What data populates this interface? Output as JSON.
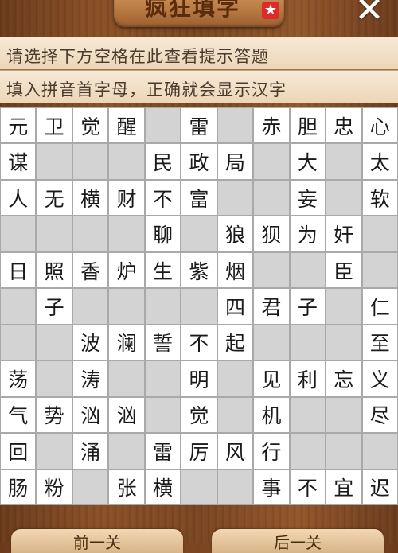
{
  "header": {
    "title": "疯狂填字",
    "close_icon": "close-icon"
  },
  "hints": {
    "line1": "请选择下方空格在此查看提示答题",
    "line2": "填入拼音首字母，正确就会显示汉字"
  },
  "grid": [
    [
      "元",
      "卫",
      "觉",
      "醒",
      "",
      "雷",
      "",
      "赤",
      "胆",
      "忠",
      "心"
    ],
    [
      "谋",
      "",
      "",
      "",
      "民",
      "政",
      "局",
      "",
      "大",
      "",
      "太"
    ],
    [
      "人",
      "无",
      "横",
      "财",
      "不",
      "富",
      "",
      "",
      "妄",
      "",
      "软"
    ],
    [
      "",
      "",
      "",
      "",
      "聊",
      "",
      "狼",
      "狈",
      "为",
      "奸",
      ""
    ],
    [
      "日",
      "照",
      "香",
      "炉",
      "生",
      "紫",
      "烟",
      "",
      "",
      "臣",
      ""
    ],
    [
      "",
      "子",
      "",
      "",
      "",
      "",
      "四",
      "君",
      "子",
      "",
      "仁"
    ],
    [
      "",
      "",
      "波",
      "澜",
      "誓",
      "不",
      "起",
      "",
      "",
      "",
      "至"
    ],
    [
      "荡",
      "",
      "涛",
      "",
      "",
      "明",
      "",
      "见",
      "利",
      "忘",
      "义"
    ],
    [
      "气",
      "势",
      "汹",
      "汹",
      "",
      "觉",
      "",
      "机",
      "",
      "",
      "尽"
    ],
    [
      "回",
      "",
      "涌",
      "",
      "雷",
      "厉",
      "风",
      "行",
      "",
      "",
      ""
    ],
    [
      "肠",
      "粉",
      "",
      "张",
      "横",
      "",
      "",
      "事",
      "不",
      "宜",
      "迟"
    ]
  ],
  "footer": {
    "prev_label": "前一关",
    "next_label": "后一关"
  }
}
